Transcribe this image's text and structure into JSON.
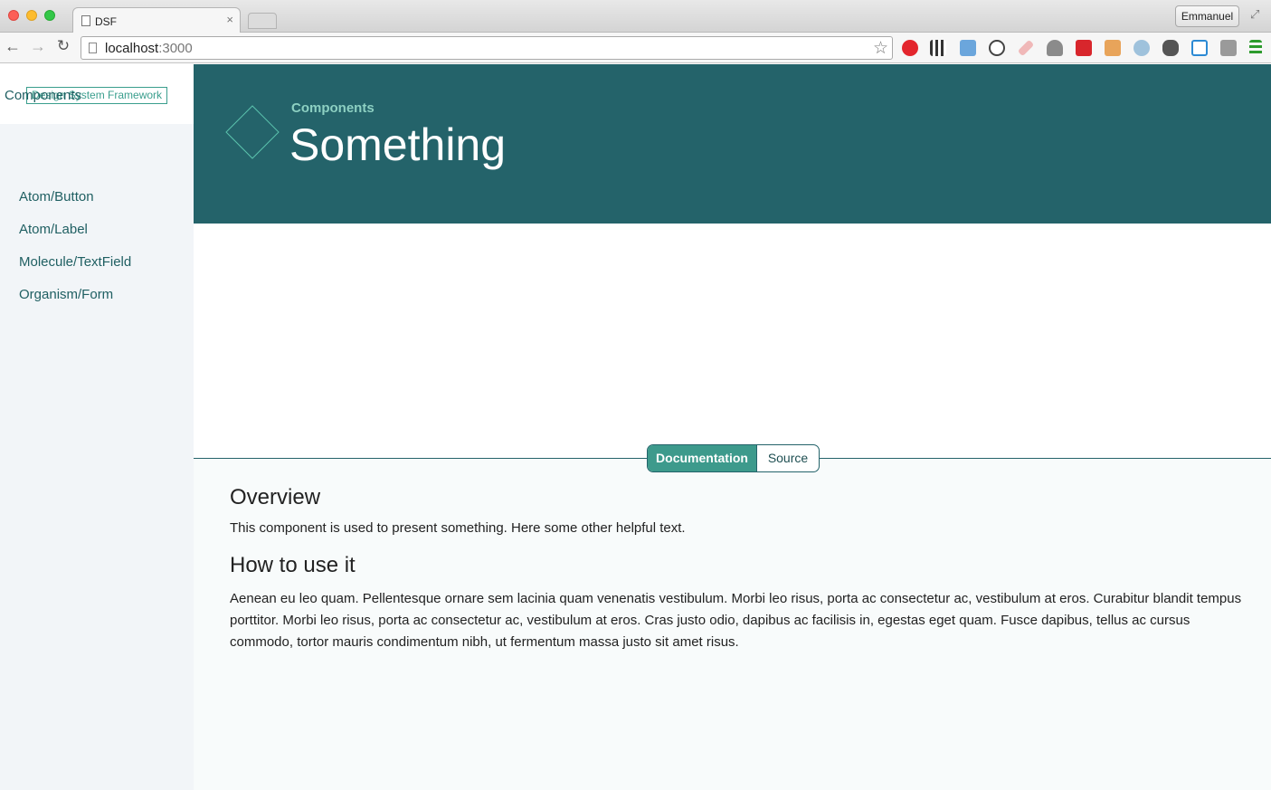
{
  "browser": {
    "tab_title": "DSF",
    "tab_close": "×",
    "profile_name": "Emmanuel",
    "url_host": "localhost",
    "url_port": ":3000",
    "extensions": [
      "opera-icon",
      "qr-code-icon",
      "folder-icon",
      "sync-icon",
      "eraser-icon",
      "ghost-off-icon",
      "cors-icon",
      "face-icon",
      "camera-icon",
      "evernote-icon",
      "calendar-icon",
      "window-icon",
      "menu-icon"
    ]
  },
  "sidebar": {
    "brand": "Design System Framework",
    "heading": "Components",
    "items": [
      {
        "label": "Atom/Button"
      },
      {
        "label": "Atom/Label"
      },
      {
        "label": "Molecule/TextField"
      },
      {
        "label": "Organism/Form"
      }
    ]
  },
  "header": {
    "eyebrow": "Components",
    "title": "Something"
  },
  "tabs": {
    "documentation": "Documentation",
    "source": "Source",
    "active": "documentation"
  },
  "docs": {
    "overview_heading": "Overview",
    "overview_text": "This component is used to present something. Here some other helpful text.",
    "usage_heading": "How to use it",
    "usage_text": "Aenean eu leo quam. Pellentesque ornare sem lacinia quam venenatis vestibulum. Morbi leo risus, porta ac consectetur ac, vestibulum at eros. Curabitur blandit tempus porttitor. Morbi leo risus, porta ac consectetur ac, vestibulum at eros. Cras justo odio, dapibus ac facilisis in, egestas eget quam. Fusce dapibus, tellus ac cursus commodo, tortor mauris condimentum nibh, ut fermentum massa justo sit amet risus."
  },
  "colors": {
    "header_bg": "#24636a",
    "accent": "#3d9a8c",
    "sidebar_bg": "#f2f5f8"
  }
}
